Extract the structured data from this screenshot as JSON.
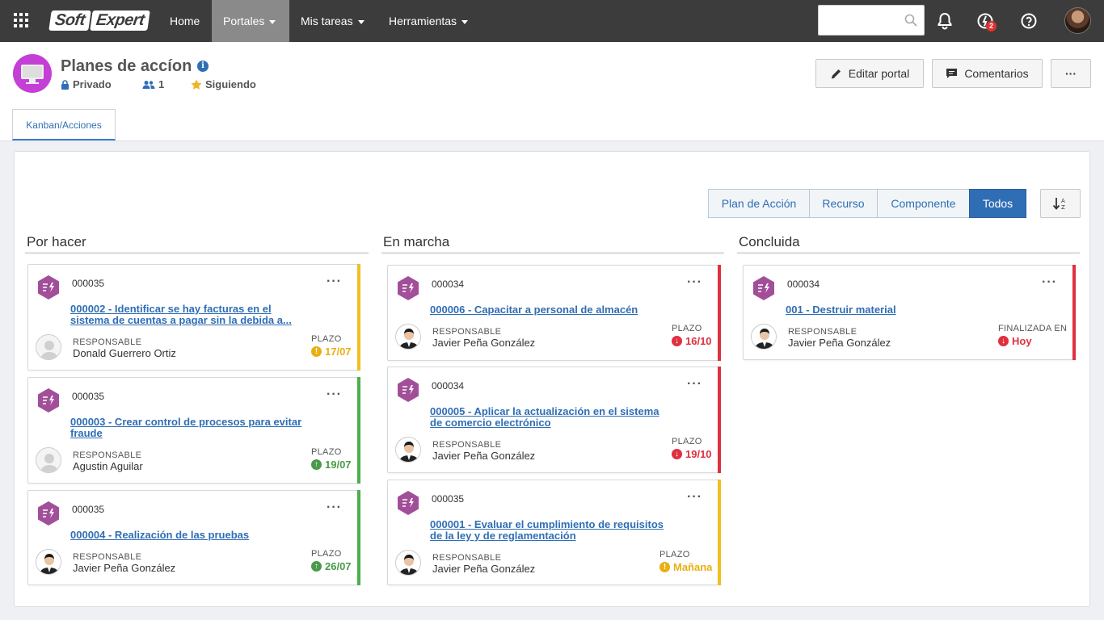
{
  "nav": {
    "logo_part1": "Soft",
    "logo_part2": "Expert",
    "items": [
      {
        "label": "Home"
      },
      {
        "label": "Portales"
      },
      {
        "label": "Mis tareas"
      },
      {
        "label": "Herramientas"
      }
    ],
    "search_value": "",
    "notification_badge": "2"
  },
  "header": {
    "title": "Planes de accíon",
    "privacy": "Privado",
    "members": "1",
    "following": "Siguiendo",
    "edit_label": "Editar portal",
    "comments_label": "Comentarios",
    "more_label": "···",
    "tab_label": "Kanban/Acciones"
  },
  "filters": {
    "items": [
      "Plan de Acción",
      "Recurso",
      "Componente",
      "Todos"
    ],
    "active": "Todos"
  },
  "columns": [
    {
      "title": "Por hacer",
      "cards": [
        {
          "code": "000035",
          "title": "000002 - Identificar se hay facturas en el sistema de cuentas a pagar sin la debida a...",
          "resp_label": "RESPONSABLE",
          "resp_name": "Donald Guerrero Ortiz",
          "plazo_label": "PLAZO",
          "plazo_value": "17/07",
          "status": "warning",
          "bar_color": "#f0c020",
          "avatar": "generic"
        },
        {
          "code": "000035",
          "title": "000003 - Crear control de procesos para evitar fraude",
          "resp_label": "RESPONSABLE",
          "resp_name": "Agustin Aguilar",
          "plazo_label": "PLAZO",
          "plazo_value": "19/07",
          "status": "ok",
          "bar_color": "#4caf50",
          "avatar": "generic"
        },
        {
          "code": "000035",
          "title": "000004 - Realización de las pruebas",
          "resp_label": "RESPONSABLE",
          "resp_name": "Javier Peña González",
          "plazo_label": "PLAZO",
          "plazo_value": "26/07",
          "status": "ok",
          "bar_color": "#4caf50",
          "avatar": "person"
        }
      ]
    },
    {
      "title": "En marcha",
      "cards": [
        {
          "code": "000034",
          "title": "000006 - Capacitar a personal de almacén",
          "resp_label": "RESPONSABLE",
          "resp_name": "Javier Peña González",
          "plazo_label": "PLAZO",
          "plazo_value": "16/10",
          "status": "late",
          "bar_color": "#e03040",
          "avatar": "person"
        },
        {
          "code": "000034",
          "title": "000005 - Aplicar la actualización en el sistema de comercio electrónico",
          "resp_label": "RESPONSABLE",
          "resp_name": "Javier Peña González",
          "plazo_label": "PLAZO",
          "plazo_value": "19/10",
          "status": "late",
          "bar_color": "#e03040",
          "avatar": "person"
        },
        {
          "code": "000035",
          "title": "000001 - Evaluar el cumplimiento de requisitos de la ley y de reglamentación",
          "resp_label": "RESPONSABLE",
          "resp_name": "Javier Peña González",
          "plazo_label": "PLAZO",
          "plazo_value": "Mañana",
          "status": "warning",
          "bar_color": "#f0c020",
          "avatar": "person"
        }
      ]
    },
    {
      "title": "Concluida",
      "cards": [
        {
          "code": "000034",
          "title": "001 - Destruir material",
          "resp_label": "RESPONSABLE",
          "resp_name": "Javier Peña González",
          "plazo_label": "FINALIZADA EN",
          "plazo_value": "Hoy",
          "status": "late",
          "bar_color": "#e03040",
          "avatar": "person"
        }
      ]
    }
  ],
  "colors": {
    "nav_bg": "#3c3c3c",
    "accent": "#2f6eb5",
    "ok": "#4a9a4a",
    "warning": "#e8b010",
    "late": "#e03040",
    "hex": "#a24f9a"
  }
}
